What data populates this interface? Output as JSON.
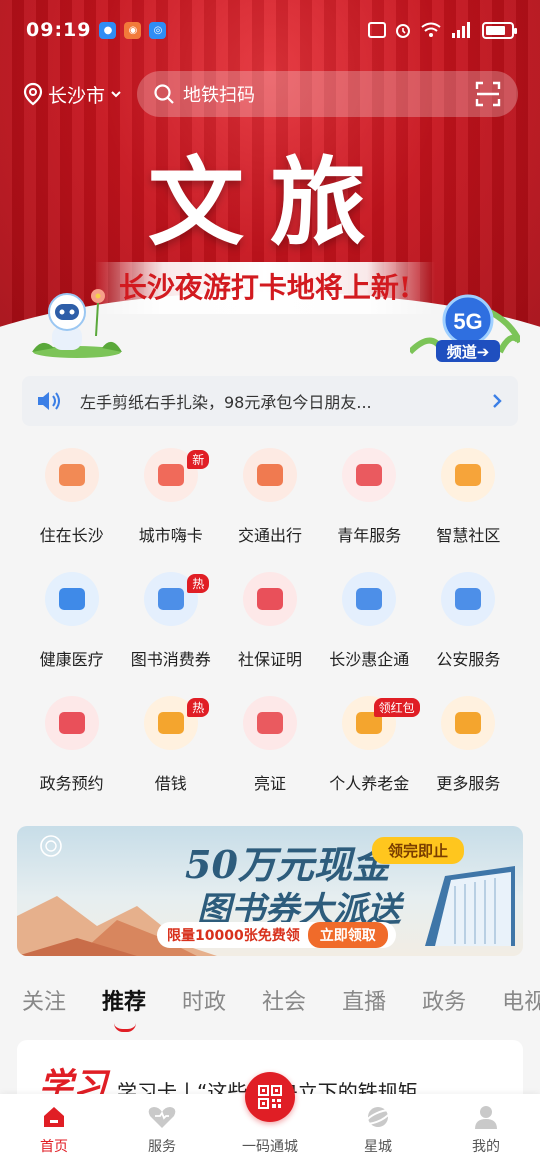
{
  "status": {
    "time": "09:19",
    "battery_level": 0.8
  },
  "location": {
    "city": "长沙市"
  },
  "search": {
    "placeholder": "地铁扫码"
  },
  "hero": {
    "title": "文旅",
    "subtitle": "长沙夜游打卡地将上新!",
    "badge_text": "5G",
    "badge_label": "频道➔"
  },
  "notice": {
    "text": "左手剪纸右手扎染，98元承包今日朋友..."
  },
  "services": [
    {
      "label": "住在长沙",
      "icon": "house-card-icon",
      "tag": ""
    },
    {
      "label": "城市嗨卡",
      "icon": "hi-card-icon",
      "tag": "新"
    },
    {
      "label": "交通出行",
      "icon": "car-icon",
      "tag": ""
    },
    {
      "label": "青年服务",
      "icon": "people-icon",
      "tag": ""
    },
    {
      "label": "智慧社区",
      "icon": "home-heart-icon",
      "tag": ""
    },
    {
      "label": "健康医疗",
      "icon": "medical-kit-icon",
      "tag": ""
    },
    {
      "label": "图书消费券",
      "icon": "book-icon",
      "tag": "热"
    },
    {
      "label": "社保证明",
      "icon": "shield-search-icon",
      "tag": ""
    },
    {
      "label": "长沙惠企通",
      "icon": "enterprise-book-icon",
      "tag": ""
    },
    {
      "label": "公安服务",
      "icon": "police-badge-icon",
      "tag": ""
    },
    {
      "label": "政务预约",
      "icon": "clock-icon",
      "tag": ""
    },
    {
      "label": "借钱",
      "icon": "yuan-hand-icon",
      "tag": "热"
    },
    {
      "label": "亮证",
      "icon": "id-card-icon",
      "tag": ""
    },
    {
      "label": "个人养老金",
      "icon": "pension-icon",
      "tag": "领红包"
    },
    {
      "label": "更多服务",
      "icon": "grid-more-icon",
      "tag": ""
    }
  ],
  "banner": {
    "line1": "50万元现金",
    "line2": "图书券大派送",
    "pill": "领完即止",
    "quota": "限量10000张免费领",
    "button": "立即领取"
  },
  "tabs": [
    "关注",
    "推荐",
    "时政",
    "社会",
    "直播",
    "政务",
    "电视"
  ],
  "active_tab": "推荐",
  "feed": {
    "logo": "学习",
    "headline": "学习卡丨“这些”中央立下的铁规矩，"
  },
  "nav": [
    {
      "label": "首页",
      "icon": "home-icon"
    },
    {
      "label": "服务",
      "icon": "service-heart-icon"
    },
    {
      "label": "一码通城",
      "icon": "qr-code-icon"
    },
    {
      "label": "星城",
      "icon": "planet-icon"
    },
    {
      "label": "我的",
      "icon": "user-icon"
    }
  ],
  "colors": {
    "brand_red": "#e01e25",
    "hero_red": "#c6131d",
    "tag_red": "#e01e25",
    "banner_blue": "#2d5c7c",
    "banner_pill": "#ffc61e"
  }
}
